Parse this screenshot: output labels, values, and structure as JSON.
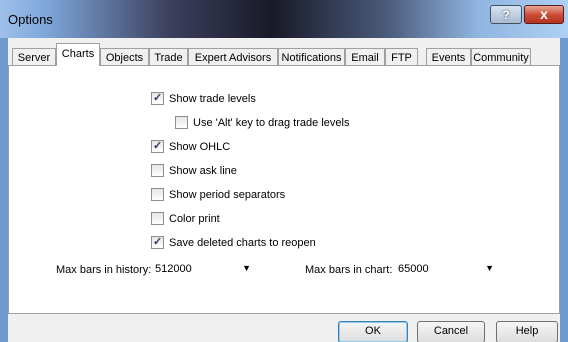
{
  "window": {
    "title": "Options",
    "help_button": "?",
    "close_button": "x"
  },
  "tabs": [
    {
      "label": "Server"
    },
    {
      "label": "Charts"
    },
    {
      "label": "Objects"
    },
    {
      "label": "Trade"
    },
    {
      "label": "Expert Advisors"
    },
    {
      "label": "Notifications"
    },
    {
      "label": "Email"
    },
    {
      "label": "FTP"
    },
    {
      "label": "Events"
    },
    {
      "label": "Community"
    }
  ],
  "active_tab": "Charts",
  "checkboxes": [
    {
      "label": "Show trade levels",
      "checked": true
    },
    {
      "label": "Use 'Alt' key to drag trade levels",
      "checked": false
    },
    {
      "label": "Show OHLC",
      "checked": true
    },
    {
      "label": "Show ask line",
      "checked": false
    },
    {
      "label": "Show period separators",
      "checked": false
    },
    {
      "label": "Color print",
      "checked": false
    },
    {
      "label": "Save deleted charts to reopen",
      "checked": true
    }
  ],
  "max_bars_history": {
    "label": "Max bars in history:",
    "value": "512000"
  },
  "max_bars_chart": {
    "label": "Max bars in chart:",
    "value": "65000"
  },
  "buttons": {
    "ok": "OK",
    "cancel": "Cancel",
    "help": "Help"
  }
}
